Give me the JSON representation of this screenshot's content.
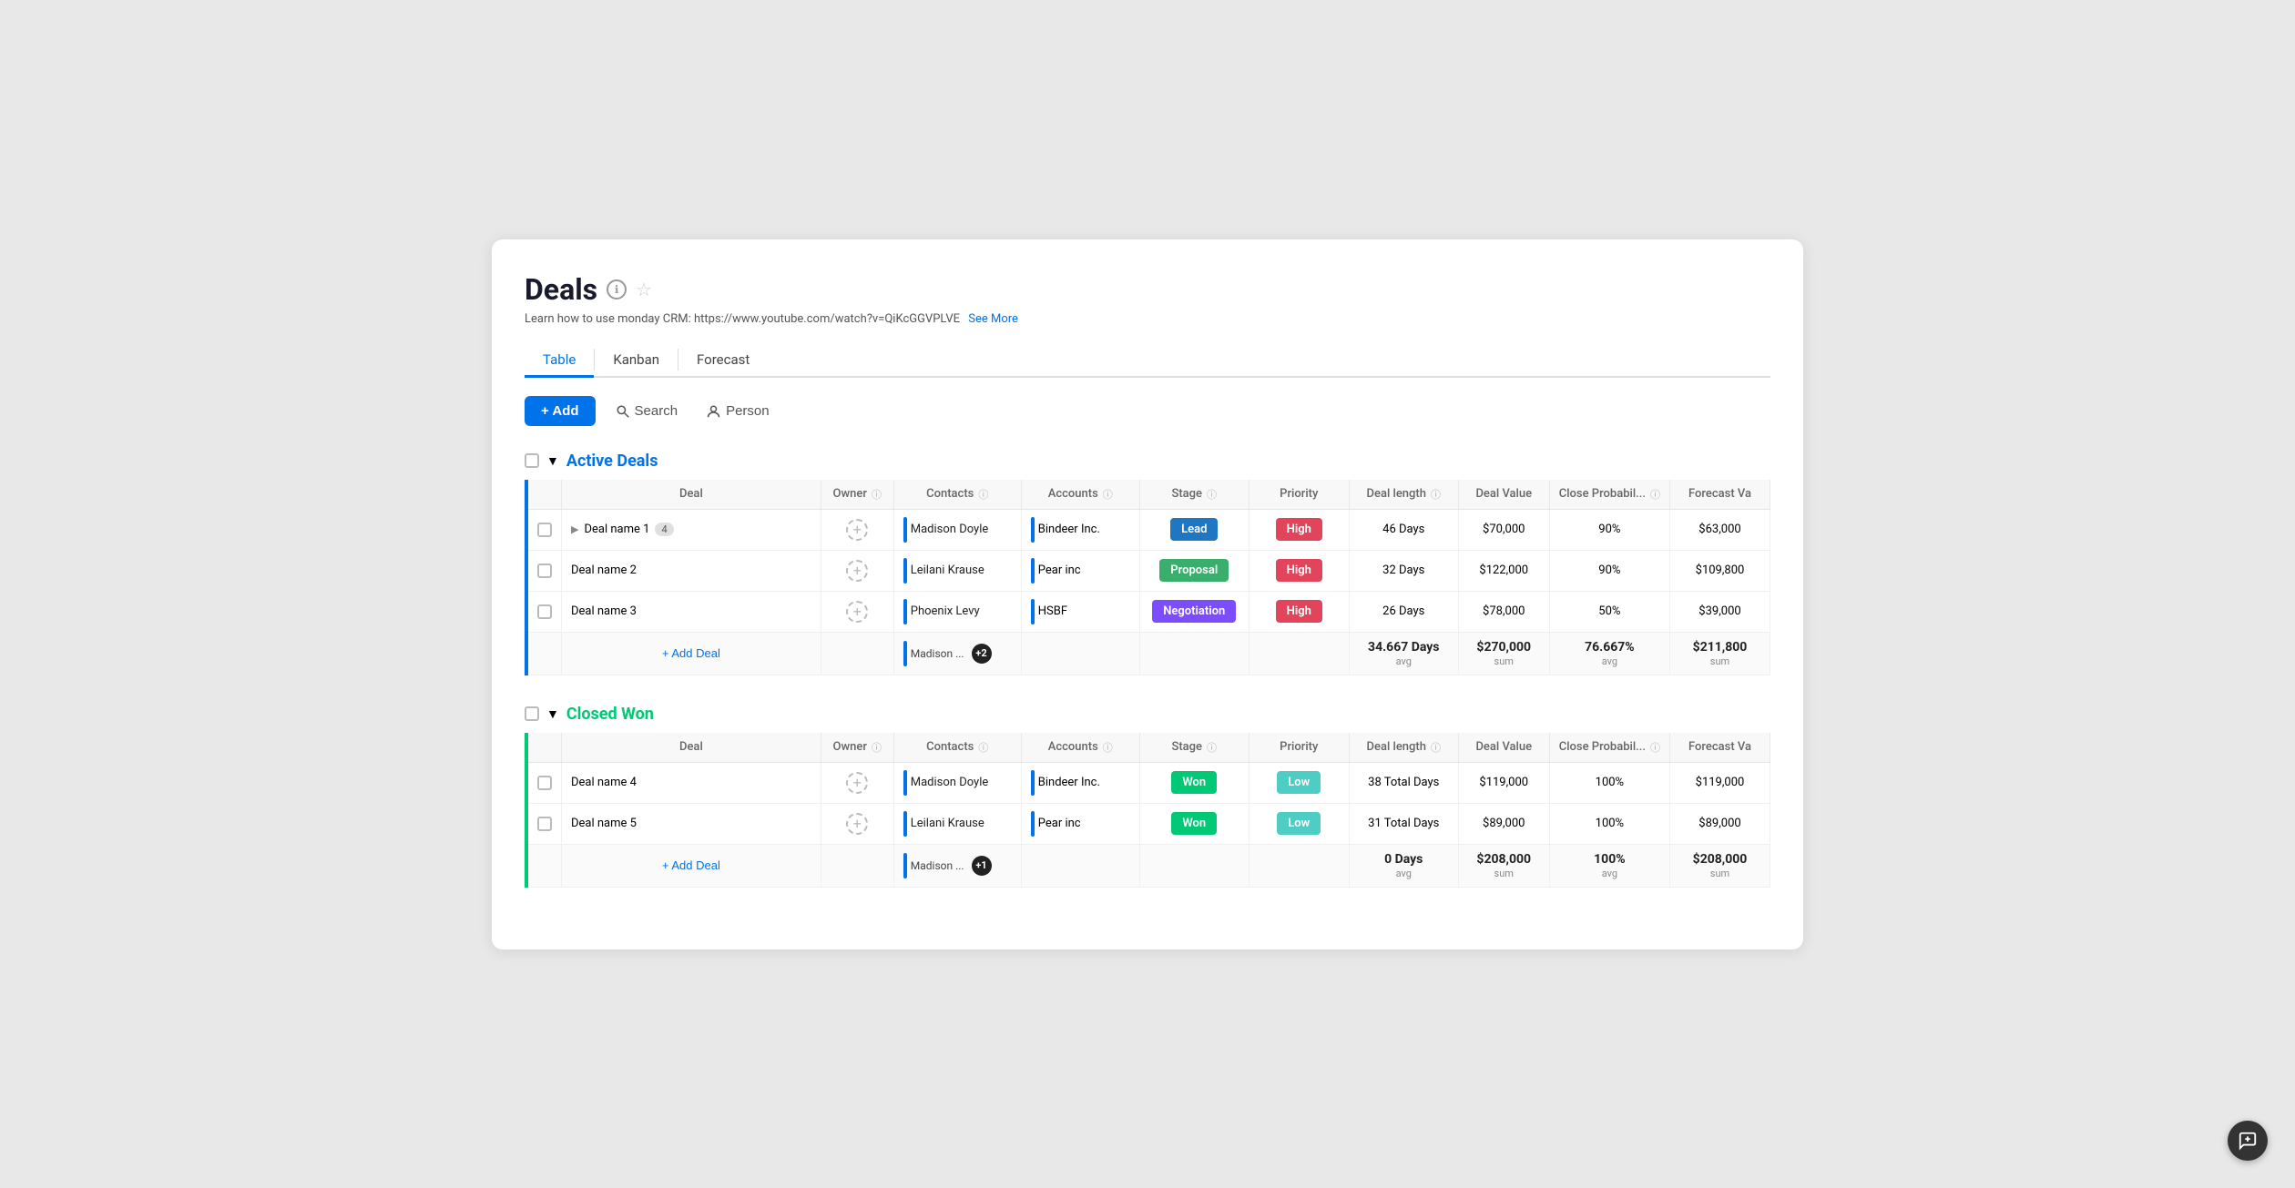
{
  "page": {
    "title": "Deals",
    "subtitle": "Learn how to use monday CRM: https://www.youtube.com/watch?v=QiKcGGVPLVE",
    "see_more": "See More"
  },
  "tabs": [
    {
      "label": "Table",
      "active": true
    },
    {
      "label": "Kanban",
      "active": false
    },
    {
      "label": "Forecast",
      "active": false
    }
  ],
  "toolbar": {
    "add_label": "+ Add",
    "search_label": "Search",
    "person_label": "Person"
  },
  "sections": [
    {
      "id": "active",
      "title": "Active Deals",
      "type": "active",
      "columns": [
        "Deal",
        "Owner",
        "Contacts",
        "Accounts",
        "Stage",
        "Priority",
        "Deal length",
        "Deal Value",
        "Close Probabil...",
        "Forecast Va"
      ],
      "rows": [
        {
          "deal_name": "Deal name 1",
          "count": 4,
          "expandable": true,
          "owner": "",
          "contacts": "Madison Doyle",
          "accounts": "Bindeer Inc.",
          "stage": "Lead",
          "stage_class": "stage-lead",
          "priority": "High",
          "priority_class": "priority-high",
          "deal_length": "46 Days",
          "deal_value": "$70,000",
          "close_prob": "90%",
          "forecast_val": "$63,000"
        },
        {
          "deal_name": "Deal name 2",
          "count": null,
          "expandable": false,
          "owner": "",
          "contacts": "Leilani Krause",
          "accounts": "Pear inc",
          "stage": "Proposal",
          "stage_class": "stage-proposal",
          "priority": "High",
          "priority_class": "priority-high",
          "deal_length": "32 Days",
          "deal_value": "$122,000",
          "close_prob": "90%",
          "forecast_val": "$109,800"
        },
        {
          "deal_name": "Deal name 3",
          "count": null,
          "expandable": false,
          "owner": "",
          "contacts": "Phoenix Levy",
          "accounts": "HSBF",
          "stage": "Negotiation",
          "stage_class": "stage-negotiation",
          "priority": "High",
          "priority_class": "priority-high",
          "deal_length": "26 Days",
          "deal_value": "$78,000",
          "close_prob": "50%",
          "forecast_val": "$39,000"
        }
      ],
      "summary": {
        "contacts": "Madison ...",
        "contacts_badge": "+2",
        "deal_length_val": "34.667 Days",
        "deal_length_sub": "avg",
        "deal_value_val": "$270,000",
        "deal_value_sub": "sum",
        "close_prob_val": "76.667%",
        "close_prob_sub": "avg",
        "forecast_val": "$211,800",
        "forecast_sub": "sum"
      },
      "add_deal_label": "+ Add Deal"
    },
    {
      "id": "closed-won",
      "title": "Closed Won",
      "type": "won",
      "columns": [
        "Deal",
        "Owner",
        "Contacts",
        "Accounts",
        "Stage",
        "Priority",
        "Deal length",
        "Deal Value",
        "Close Probabil...",
        "Forecast Va"
      ],
      "rows": [
        {
          "deal_name": "Deal name 4",
          "count": null,
          "expandable": false,
          "owner": "",
          "contacts": "Madison Doyle",
          "accounts": "Bindeer Inc.",
          "stage": "Won",
          "stage_class": "stage-won",
          "priority": "Low",
          "priority_class": "priority-low",
          "deal_length": "38 Total Days",
          "deal_value": "$119,000",
          "close_prob": "100%",
          "forecast_val": "$119,000"
        },
        {
          "deal_name": "Deal name 5",
          "count": null,
          "expandable": false,
          "owner": "",
          "contacts": "Leilani Krause",
          "accounts": "Pear inc",
          "stage": "Won",
          "stage_class": "stage-won",
          "priority": "Low",
          "priority_class": "priority-low",
          "deal_length": "31 Total Days",
          "deal_value": "$89,000",
          "close_prob": "100%",
          "forecast_val": "$89,000"
        }
      ],
      "summary": {
        "contacts": "Madison ...",
        "contacts_badge": "+1",
        "deal_length_val": "0 Days",
        "deal_length_sub": "avg",
        "deal_value_val": "$208,000",
        "deal_value_sub": "sum",
        "close_prob_val": "100%",
        "close_prob_sub": "avg",
        "forecast_val": "$208,000",
        "forecast_sub": "sum"
      },
      "add_deal_label": "+ Add Deal"
    }
  ]
}
